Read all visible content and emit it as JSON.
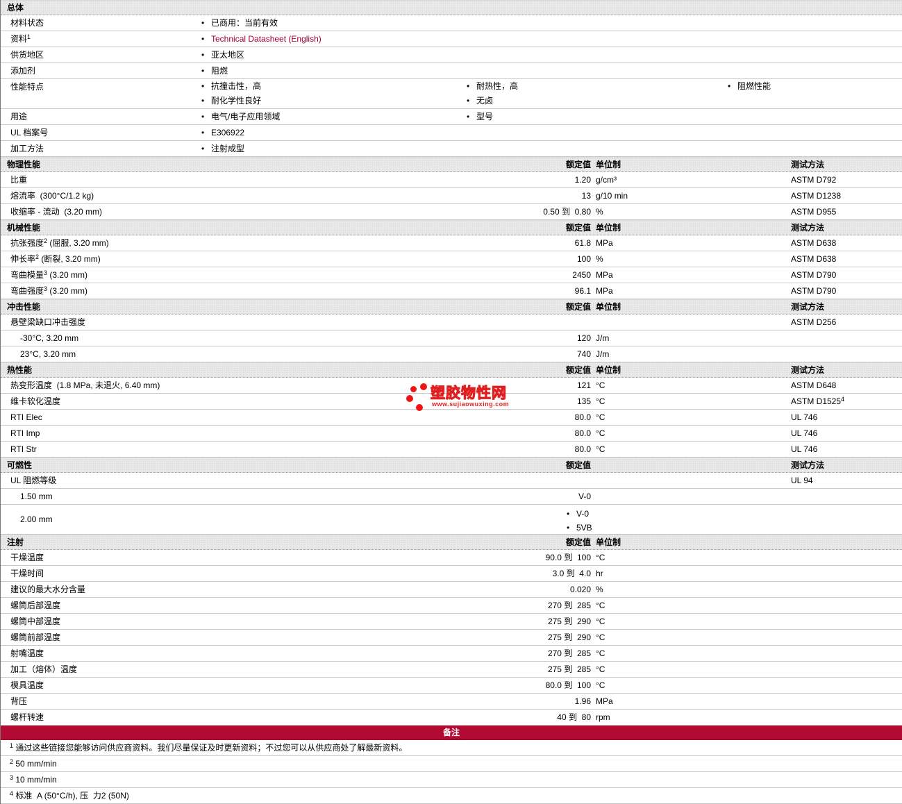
{
  "colors": {
    "section_bar_bg": "#ebebeb",
    "row_border": "#c9c9c9",
    "notes_band_bg": "#b20a33",
    "link_color": "#a00030",
    "watermark_red": "#ee1414",
    "text": "#000000"
  },
  "watermark": {
    "title": "塑胶物性网",
    "url": "www.sujiaowuxing.com"
  },
  "headers": {
    "rated": "额定值",
    "unit": "单位制",
    "method": "测试方法"
  },
  "general": {
    "title": "总体",
    "rows": [
      {
        "label": "材料状态",
        "cols": [
          [
            "已商用：当前有效"
          ]
        ]
      },
      {
        "label": "资料",
        "sup": "1",
        "link": true,
        "cols": [
          [
            "Technical Datasheet (English)"
          ]
        ]
      },
      {
        "label": "供货地区",
        "cols": [
          [
            "亚太地区"
          ]
        ]
      },
      {
        "label": "添加剂",
        "cols": [
          [
            "阻燃"
          ]
        ]
      },
      {
        "label": "性能特点",
        "cols": [
          [
            "抗撞击性，高",
            "耐化学性良好"
          ],
          [
            "耐热性，高",
            "无卤"
          ],
          [
            "阻燃性能"
          ]
        ]
      },
      {
        "label": "用途",
        "cols": [
          [
            "电气/电子应用领域"
          ],
          [
            "型号"
          ]
        ]
      },
      {
        "label": "UL 档案号",
        "cols": [
          [
            "E306922"
          ]
        ]
      },
      {
        "label": "加工方法",
        "cols": [
          [
            "注射成型"
          ]
        ]
      }
    ]
  },
  "sections": [
    {
      "id": "physical",
      "title": "物理性能",
      "unit_header": true,
      "method_header": true,
      "rows": [
        {
          "label": "比重",
          "value": "1.20",
          "unit": "g/cm³",
          "method": "ASTM D792"
        },
        {
          "label": "熔流率  (300°C/1.2 kg)",
          "value": "13",
          "unit": "g/10 min",
          "method": "ASTM D1238"
        },
        {
          "label": "收缩率 - 流动  (3.20 mm)",
          "value": "0.50 到  0.80",
          "unit": "%",
          "method": "ASTM D955"
        }
      ]
    },
    {
      "id": "mechanical",
      "title": "机械性能",
      "unit_header": true,
      "method_header": true,
      "rows": [
        {
          "label": "抗张强度",
          "sup": "2",
          "suffix": " (屈服, 3.20 mm)",
          "value": "61.8",
          "unit": "MPa",
          "method": "ASTM D638"
        },
        {
          "label": "伸长率",
          "sup": "2",
          "suffix": " (断裂, 3.20 mm)",
          "value": "100",
          "unit": "%",
          "method": "ASTM D638"
        },
        {
          "label": "弯曲模量",
          "sup": "3",
          "suffix": " (3.20 mm)",
          "value": "2450",
          "unit": "MPa",
          "method": "ASTM D790"
        },
        {
          "label": "弯曲强度",
          "sup": "3",
          "suffix": " (3.20 mm)",
          "value": "96.1",
          "unit": "MPa",
          "method": "ASTM D790"
        }
      ]
    },
    {
      "id": "impact",
      "title": "冲击性能",
      "unit_header": true,
      "method_header": true,
      "rows": [
        {
          "label": "悬壁梁缺口冲击强度",
          "method": "ASTM D256"
        },
        {
          "label": "-30°C, 3.20 mm",
          "indent": true,
          "value": "120",
          "unit": "J/m"
        },
        {
          "label": "23°C, 3.20 mm",
          "indent": true,
          "value": "740",
          "unit": "J/m"
        }
      ]
    },
    {
      "id": "thermal",
      "title": "热性能",
      "unit_header": true,
      "method_header": true,
      "rows": [
        {
          "label": "热变形温度  (1.8 MPa, 未退火, 6.40 mm)",
          "value": "121",
          "unit": "°C",
          "method": "ASTM D648"
        },
        {
          "label": "维卡软化温度",
          "value": "135",
          "unit": "°C",
          "method": "ASTM D1525",
          "method_sup": "4"
        },
        {
          "label": "RTI Elec",
          "value": "80.0",
          "unit": "°C",
          "method": "UL 746"
        },
        {
          "label": "RTI Imp",
          "value": "80.0",
          "unit": "°C",
          "method": "UL 746"
        },
        {
          "label": "RTI Str",
          "value": "80.0",
          "unit": "°C",
          "method": "UL 746"
        }
      ]
    },
    {
      "id": "flammability",
      "title": "可燃性",
      "unit_header": false,
      "method_header": true,
      "rows": [
        {
          "label": "UL 阻燃等级",
          "method": "UL 94"
        },
        {
          "label": "1.50 mm",
          "indent": true,
          "value": "V-0"
        },
        {
          "label": "2.00 mm",
          "indent": true,
          "value_bullets": [
            "V-0",
            "5VB"
          ]
        }
      ]
    },
    {
      "id": "injection",
      "title": "注射",
      "unit_header": true,
      "method_header": false,
      "rows": [
        {
          "label": "干燥温度",
          "value": "90.0 到  100",
          "unit": "°C"
        },
        {
          "label": "干燥时间",
          "value": "3.0 到  4.0",
          "unit": "hr"
        },
        {
          "label": "建议的最大水分含量",
          "value": "0.020",
          "unit": "%"
        },
        {
          "label": "螺筒后部温度",
          "value": "270 到  285",
          "unit": "°C"
        },
        {
          "label": "螺筒中部温度",
          "value": "275 到  290",
          "unit": "°C"
        },
        {
          "label": "螺筒前部温度",
          "value": "275 到  290",
          "unit": "°C"
        },
        {
          "label": "射嘴温度",
          "value": "270 到  285",
          "unit": "°C"
        },
        {
          "label": "加工（熔体）温度",
          "value": "275 到  285",
          "unit": "°C"
        },
        {
          "label": "模具温度",
          "value": "80.0 到  100",
          "unit": "°C"
        },
        {
          "label": "背压",
          "value": "1.96",
          "unit": "MPa"
        },
        {
          "label": "螺杆转速",
          "value": "40 到  80",
          "unit": "rpm"
        }
      ]
    }
  ],
  "notes": {
    "band_label": "备注",
    "items": [
      {
        "sup": "1",
        "text": "通过这些链接您能够访问供应商资料。我们尽量保证及时更新资料；不过您可以从供应商处了解最新资料。"
      },
      {
        "sup": "2",
        "text": "50 mm/min"
      },
      {
        "sup": "3",
        "text": "10 mm/min"
      },
      {
        "sup": "4",
        "text": "标准  A (50°C/h), 压  力2 (50N)"
      }
    ]
  }
}
